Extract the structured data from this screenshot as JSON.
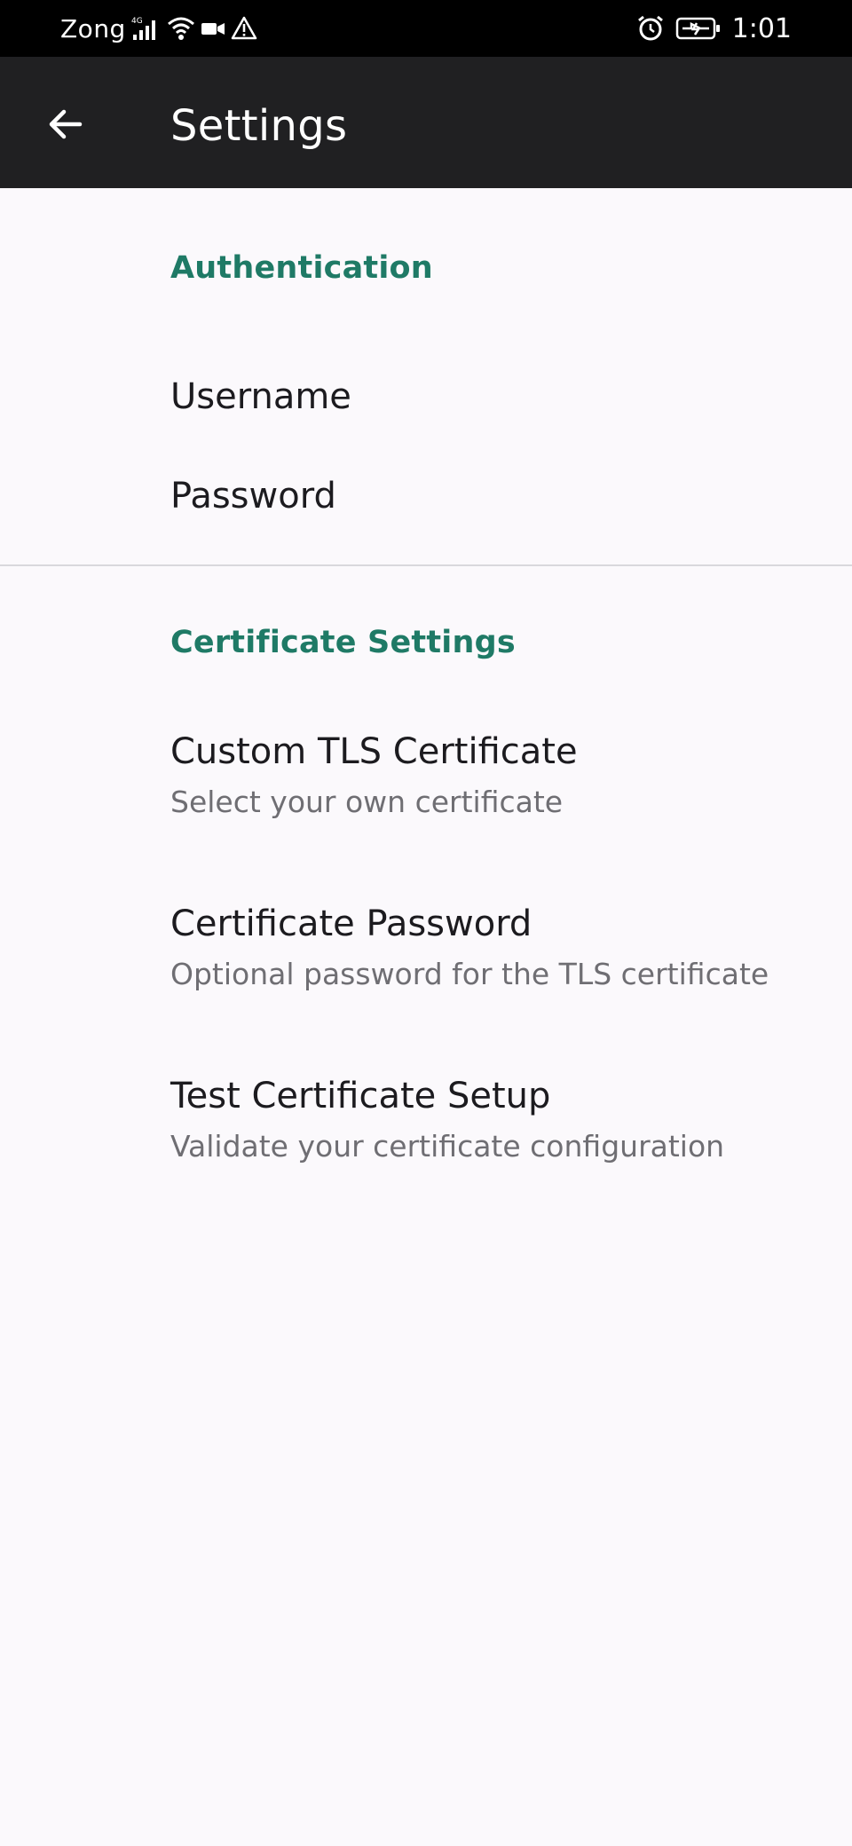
{
  "status_bar": {
    "carrier": "Zong",
    "network_type": "4G",
    "time": "1:01",
    "icons_left": [
      "signal-icon",
      "wifi-icon",
      "video-camera-icon",
      "warning-icon"
    ],
    "icons_right": [
      "alarm-icon",
      "battery-charging-icon"
    ]
  },
  "app_bar": {
    "title": "Settings",
    "back_icon": "arrow-left-icon"
  },
  "sections": [
    {
      "header": "Authentication",
      "items": [
        {
          "title": "Username"
        },
        {
          "title": "Password"
        }
      ]
    },
    {
      "header": "Certificate Settings",
      "items": [
        {
          "title": "Custom TLS Certificate",
          "summary": "Select your own certificate"
        },
        {
          "title": "Certificate Password",
          "summary": "Optional password for the TLS certificate"
        },
        {
          "title": "Test Certificate Setup",
          "summary": "Validate your certificate configuration"
        }
      ]
    }
  ],
  "colors": {
    "accent": "#1f7a66",
    "app_bar": "#202022",
    "background": "#fbf9fc",
    "status_bar": "#000000"
  }
}
